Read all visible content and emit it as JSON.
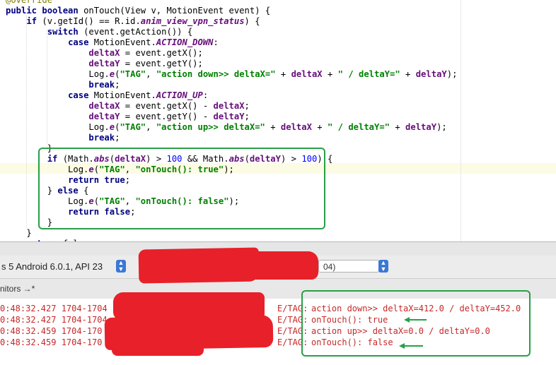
{
  "editor": {
    "lines": [
      {
        "tokens": [
          {
            "t": "@Override",
            "c": "ann"
          }
        ]
      },
      {
        "tokens": [
          {
            "t": "public boolean ",
            "c": "kw"
          },
          {
            "t": "onTouch(View v, MotionEvent event) {"
          }
        ]
      },
      {
        "tokens": [
          {
            "t": "    "
          },
          {
            "t": "if ",
            "c": "kw"
          },
          {
            "t": "(v.getId() == R.id."
          },
          {
            "t": "anim_view_vpn_status",
            "c": "fld"
          },
          {
            "t": ") {"
          }
        ]
      },
      {
        "tokens": [
          {
            "t": "        "
          },
          {
            "t": "switch ",
            "c": "kw"
          },
          {
            "t": "(event.getAction()) {"
          }
        ]
      },
      {
        "tokens": [
          {
            "t": "            "
          },
          {
            "t": "case ",
            "c": "kw"
          },
          {
            "t": "MotionEvent."
          },
          {
            "t": "ACTION_DOWN",
            "c": "fld"
          },
          {
            "t": ":"
          }
        ]
      },
      {
        "tokens": [
          {
            "t": "                "
          },
          {
            "t": "deltaX",
            "c": "var"
          },
          {
            "t": " = event.getX();"
          }
        ]
      },
      {
        "tokens": [
          {
            "t": "                "
          },
          {
            "t": "deltaY",
            "c": "var"
          },
          {
            "t": " = event.getY();"
          }
        ]
      },
      {
        "tokens": [
          {
            "t": "                Log."
          },
          {
            "t": "e",
            "c": "fld"
          },
          {
            "t": "("
          },
          {
            "t": "\"TAG\"",
            "c": "str"
          },
          {
            "t": ", "
          },
          {
            "t": "\"action down>> deltaX=\"",
            "c": "str"
          },
          {
            "t": " + "
          },
          {
            "t": "deltaX",
            "c": "var"
          },
          {
            "t": " + "
          },
          {
            "t": "\" / deltaY=\"",
            "c": "str"
          },
          {
            "t": " + "
          },
          {
            "t": "deltaY",
            "c": "var"
          },
          {
            "t": ");"
          }
        ]
      },
      {
        "tokens": [
          {
            "t": "                "
          },
          {
            "t": "break",
            "c": "kw"
          },
          {
            "t": ";"
          }
        ]
      },
      {
        "tokens": [
          {
            "t": "            "
          },
          {
            "t": "case ",
            "c": "kw"
          },
          {
            "t": "MotionEvent."
          },
          {
            "t": "ACTION_UP",
            "c": "fld"
          },
          {
            "t": ":"
          }
        ]
      },
      {
        "tokens": [
          {
            "t": "                "
          },
          {
            "t": "deltaX",
            "c": "var"
          },
          {
            "t": " = event.getX() - "
          },
          {
            "t": "deltaX",
            "c": "var"
          },
          {
            "t": ";"
          }
        ]
      },
      {
        "tokens": [
          {
            "t": "                "
          },
          {
            "t": "deltaY",
            "c": "var"
          },
          {
            "t": " = event.getY() - "
          },
          {
            "t": "deltaY",
            "c": "var"
          },
          {
            "t": ";"
          }
        ]
      },
      {
        "tokens": [
          {
            "t": "                Log."
          },
          {
            "t": "e",
            "c": "fld"
          },
          {
            "t": "("
          },
          {
            "t": "\"TAG\"",
            "c": "str"
          },
          {
            "t": ", "
          },
          {
            "t": "\"action up>> deltaX=\"",
            "c": "str"
          },
          {
            "t": " + "
          },
          {
            "t": "deltaX",
            "c": "var"
          },
          {
            "t": " + "
          },
          {
            "t": "\" / deltaY=\"",
            "c": "str"
          },
          {
            "t": " + "
          },
          {
            "t": "deltaY",
            "c": "var"
          },
          {
            "t": ");"
          }
        ]
      },
      {
        "tokens": [
          {
            "t": "                "
          },
          {
            "t": "break",
            "c": "kw"
          },
          {
            "t": ";"
          }
        ]
      },
      {
        "tokens": [
          {
            "t": "        }"
          }
        ]
      },
      {
        "tokens": [
          {
            "t": "        "
          },
          {
            "t": "if ",
            "c": "kw"
          },
          {
            "t": "(Math."
          },
          {
            "t": "abs",
            "c": "fld"
          },
          {
            "t": "("
          },
          {
            "t": "deltaX",
            "c": "var"
          },
          {
            "t": ") > "
          },
          {
            "t": "100",
            "c": "num"
          },
          {
            "t": " && Math."
          },
          {
            "t": "abs",
            "c": "fld"
          },
          {
            "t": "("
          },
          {
            "t": "deltaY",
            "c": "var"
          },
          {
            "t": ") > "
          },
          {
            "t": "100",
            "c": "num"
          },
          {
            "t": ") {"
          }
        ]
      },
      {
        "tokens": [
          {
            "t": "            Log."
          },
          {
            "t": "e",
            "c": "fld"
          },
          {
            "t": "("
          },
          {
            "t": "\"TAG\"",
            "c": "str"
          },
          {
            "t": ", "
          },
          {
            "t": "\"onTouch(): true\"",
            "c": "str"
          },
          {
            "t": ");"
          }
        ]
      },
      {
        "tokens": [
          {
            "t": "            "
          },
          {
            "t": "return true",
            "c": "kw"
          },
          {
            "t": ";"
          }
        ]
      },
      {
        "tokens": [
          {
            "t": "        } "
          },
          {
            "t": "else ",
            "c": "kw"
          },
          {
            "t": "{"
          }
        ]
      },
      {
        "tokens": [
          {
            "t": "            Log."
          },
          {
            "t": "e",
            "c": "fld"
          },
          {
            "t": "("
          },
          {
            "t": "\"TAG\"",
            "c": "str"
          },
          {
            "t": ", "
          },
          {
            "t": "\"onTouch(): false\"",
            "c": "str"
          },
          {
            "t": ");"
          }
        ]
      },
      {
        "tokens": [
          {
            "t": "            "
          },
          {
            "t": "return false",
            "c": "kw"
          },
          {
            "t": ";"
          }
        ]
      },
      {
        "tokens": [
          {
            "t": "        }"
          }
        ]
      },
      {
        "tokens": [
          {
            "t": "    }"
          }
        ]
      },
      {
        "tokens": [
          {
            "t": "    "
          },
          {
            "t": "return ",
            "c": "kw"
          },
          {
            "t": "false;"
          }
        ]
      }
    ]
  },
  "device_bar": {
    "device_label": "s 5 Android 6.0.1, API 23",
    "process_label": "04)",
    "select_icon": "updown-chevron-icon"
  },
  "tabs": {
    "monitors_label": "nitors →*"
  },
  "logcat": {
    "lines": [
      {
        "time": "0:48:32.427 1704-1704",
        "tag": "E/TAG:",
        "msg": "action down>> deltaX=412.0 / deltaY=452.0"
      },
      {
        "time": "0:48:32.427 1704-1704",
        "tag": "E/TAG:",
        "msg": "onTouch(): true"
      },
      {
        "time": "0:48:32.459 1704-170",
        "tag": "E/TAG:",
        "msg": "action up>> deltaX=0.0 / deltaY=0.0"
      },
      {
        "time": "0:48:32.459 1704-170",
        "tag": "E/TAG:",
        "msg": "onTouch(): false"
      }
    ]
  },
  "colors": {
    "keyword": "#000080",
    "string": "#008000",
    "field": "#660e7a",
    "log_error": "#c62828",
    "annotation_box": "#27a046",
    "redaction": "#e8202a"
  }
}
